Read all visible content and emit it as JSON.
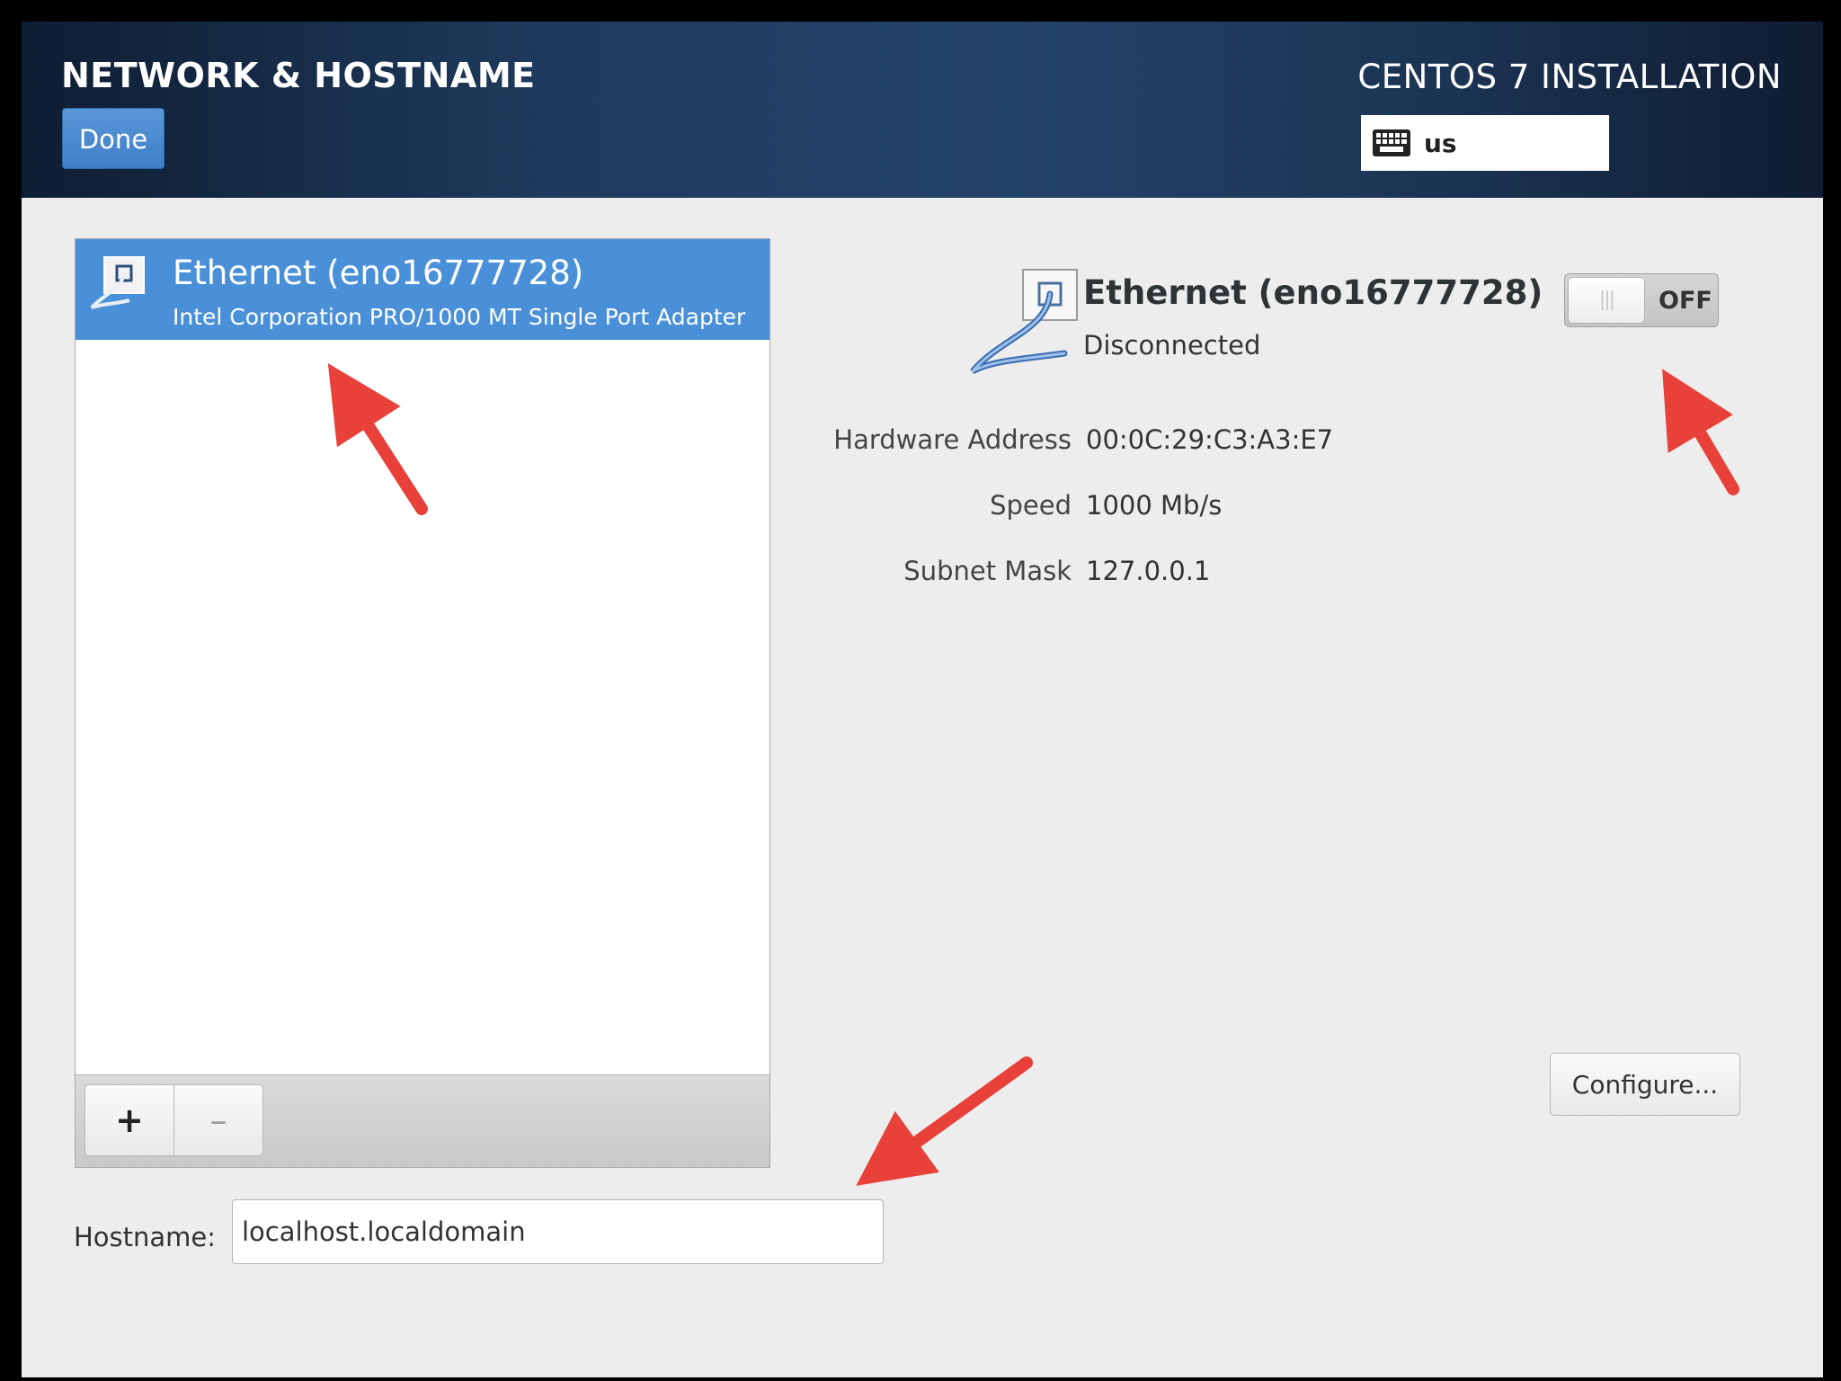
{
  "header": {
    "spoke_title": "NETWORK & HOSTNAME",
    "done_label": "Done",
    "product_title": "CENTOS 7 INSTALLATION",
    "keyboard_layout": "us"
  },
  "device_list": {
    "items": [
      {
        "name": "Ethernet (eno16777728)",
        "description": "Intel Corporation PRO/1000 MT Single Port Adapter",
        "selected": true
      }
    ],
    "add_label": "+",
    "remove_label": "–"
  },
  "details": {
    "name": "Ethernet (eno16777728)",
    "status": "Disconnected",
    "switch_state": "OFF",
    "properties": [
      {
        "key": "Hardware Address",
        "value": "00:0C:29:C3:A3:E7"
      },
      {
        "key": "Speed",
        "value": "1000 Mb/s"
      },
      {
        "key": "Subnet Mask",
        "value": "127.0.0.1"
      }
    ],
    "configure_label": "Configure..."
  },
  "hostname": {
    "label": "Hostname:",
    "value": "localhost.localdomain"
  },
  "colors": {
    "selection": "#4a90d9",
    "header_dark": "#0f1d33",
    "annotation_arrow": "#e8413a"
  }
}
